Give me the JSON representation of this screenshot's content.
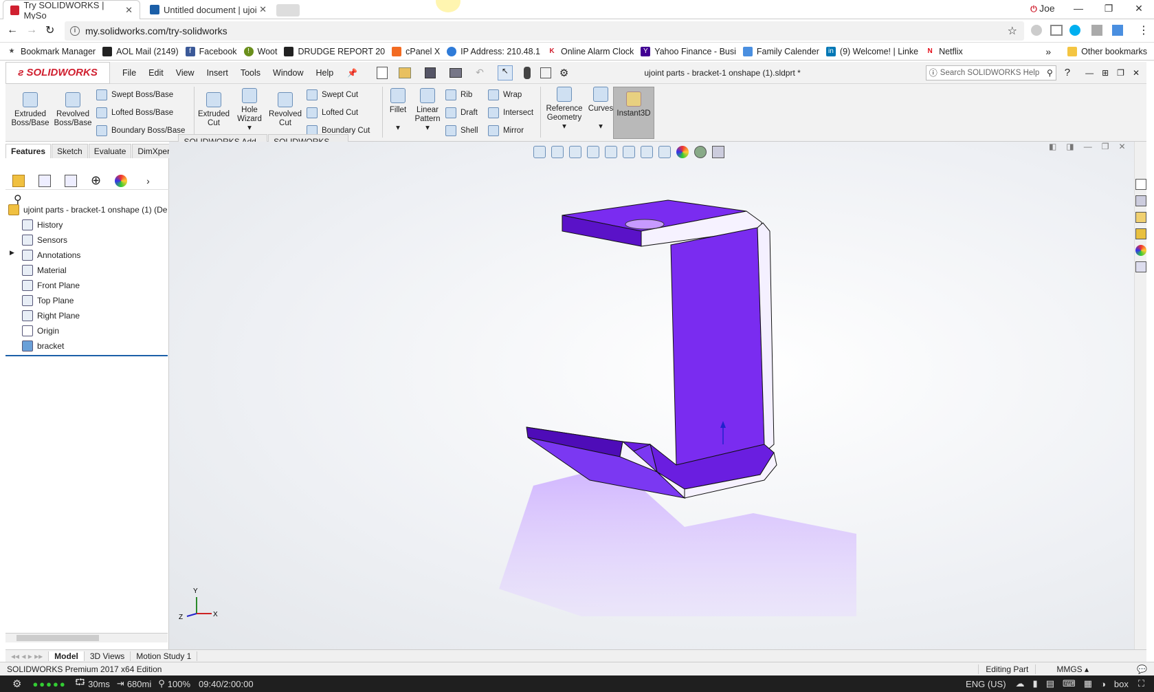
{
  "browser": {
    "tabs": [
      {
        "label": "Try SOLIDWORKS | MySo"
      },
      {
        "label": "Untitled document | ujoi"
      }
    ],
    "profile": "Joe",
    "url": "my.solidworks.com/try-solidworks",
    "bookmarks": [
      "Bookmark Manager",
      "AOL Mail (2149)",
      "Facebook",
      "Woot",
      "DRUDGE REPORT 20",
      "cPanel X",
      "IP Address: 210.48.1",
      "Online Alarm Clock",
      "Yahoo Finance - Busi",
      "Family Calender",
      "(9) Welcome! | Linke",
      "Netflix"
    ],
    "other_bookmarks": "Other bookmarks",
    "overflow": "»"
  },
  "app": {
    "logo": "SOLIDWORKS",
    "menus": [
      "File",
      "Edit",
      "View",
      "Insert",
      "Tools",
      "Window",
      "Help"
    ],
    "doc_title": "ujoint parts - bracket-1 onshape (1).sldprt *",
    "search_placeholder": "Search SOLIDWORKS Help",
    "help": "?"
  },
  "ribbon": {
    "extruded_boss": "Extruded Boss/Base",
    "revolved_boss": "Revolved Boss/Base",
    "swept_boss": "Swept Boss/Base",
    "lofted_boss": "Lofted Boss/Base",
    "boundary_boss": "Boundary Boss/Base",
    "extruded_cut": "Extruded Cut",
    "hole_wizard": "Hole Wizard",
    "revolved_cut": "Revolved Cut",
    "swept_cut": "Swept Cut",
    "lofted_cut": "Lofted Cut",
    "boundary_cut": "Boundary Cut",
    "fillet": "Fillet",
    "linear_pattern": "Linear Pattern",
    "rib": "Rib",
    "draft": "Draft",
    "shell": "Shell",
    "wrap": "Wrap",
    "intersect": "Intersect",
    "mirror": "Mirror",
    "reference_geometry": "Reference Geometry",
    "curves": "Curves",
    "instant3d": "Instant3D"
  },
  "cm_tabs": [
    "Features",
    "Sketch",
    "Evaluate",
    "DimXpert",
    "SOLIDWORKS Add-Ins",
    "SOLIDWORKS MBD"
  ],
  "tree": {
    "root": "ujoint parts - bracket-1 onshape (1)  (De",
    "items": [
      "History",
      "Sensors",
      "Annotations",
      "Material",
      "Front Plane",
      "Top Plane",
      "Right Plane",
      "Origin",
      "bracket"
    ]
  },
  "triad": {
    "y": "Y",
    "z": "Z",
    "x": "X"
  },
  "bottom_tabs": [
    "Model",
    "3D Views",
    "Motion Study 1"
  ],
  "status": {
    "edition": "SOLIDWORKS Premium 2017 x64 Edition",
    "mode": "Editing Part",
    "units": "MMGS"
  },
  "taskbar": {
    "ping": "30ms",
    "distance": "680mi",
    "zoom": "100%",
    "time": "09:40/2:00:00",
    "lang": "ENG (US)",
    "box": "box"
  },
  "colors": {
    "part": "#7a2cf0",
    "part_dark": "#5a12c8",
    "part_light": "#9a5cff"
  }
}
